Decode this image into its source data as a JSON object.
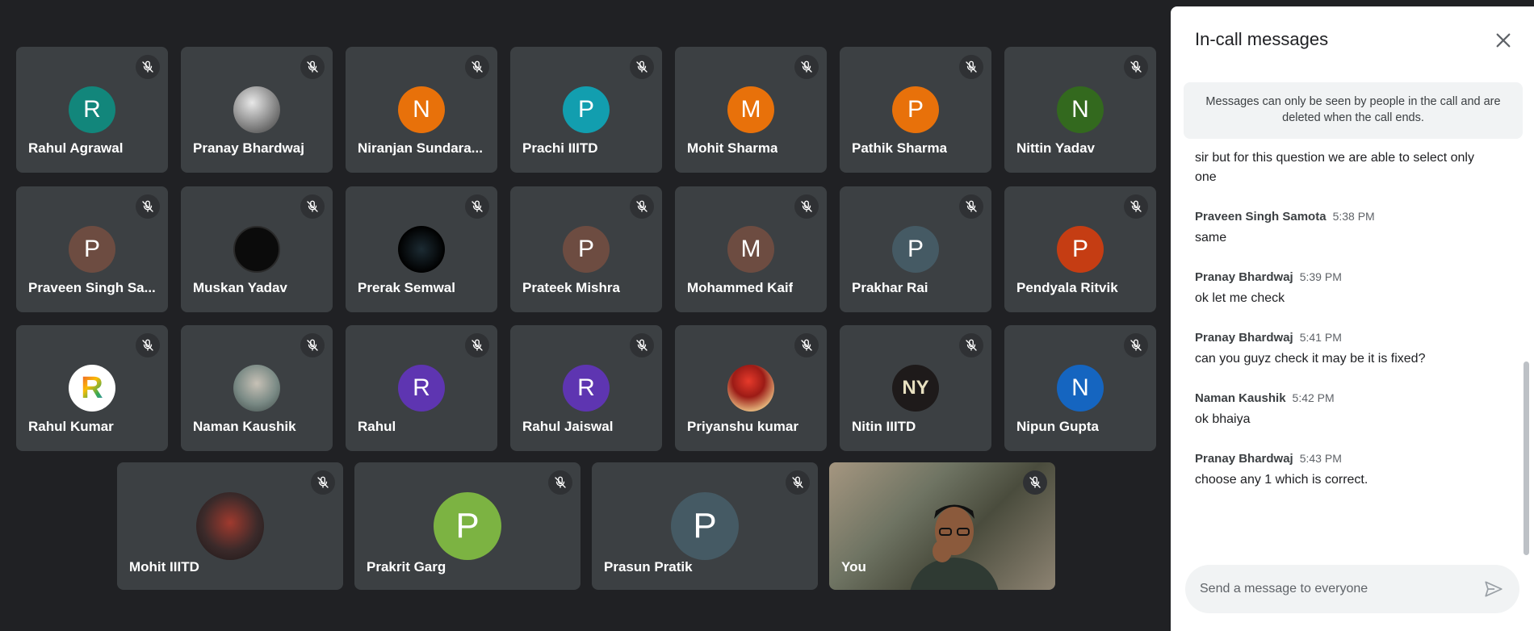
{
  "participants_row1": [
    {
      "name": "Rahul Agrawal",
      "initial": "R",
      "color": "#12867b"
    },
    {
      "name": "Pranay Bhardwaj",
      "initial": "",
      "photo": "photo-plain"
    },
    {
      "name": "Niranjan Sundara...",
      "initial": "N",
      "color": "#e8710a"
    },
    {
      "name": "Prachi IIITD",
      "initial": "P",
      "color": "#129eaf"
    },
    {
      "name": "Mohit Sharma",
      "initial": "M",
      "color": "#e8710a"
    },
    {
      "name": "Pathik Sharma",
      "initial": "P",
      "color": "#e8710a"
    },
    {
      "name": "Nittin Yadav",
      "initial": "N",
      "color": "#33691e"
    }
  ],
  "participants_row2": [
    {
      "name": "Praveen Singh Sa...",
      "initial": "P",
      "color": "#6d4c41"
    },
    {
      "name": "Muskan Yadav",
      "initial": "",
      "photo": "photo-black"
    },
    {
      "name": "Prerak Semwal",
      "initial": "",
      "photo": "photo-dark"
    },
    {
      "name": "Prateek Mishra",
      "initial": "P",
      "color": "#6d4c41"
    },
    {
      "name": "Mohammed Kaif",
      "initial": "M",
      "color": "#6d4c41"
    },
    {
      "name": "Prakhar Rai",
      "initial": "P",
      "color": "#455a64"
    },
    {
      "name": "Pendyala Ritvik",
      "initial": "P",
      "color": "#c53d13"
    }
  ],
  "participants_row3": [
    {
      "name": "Rahul Kumar",
      "initial": "R",
      "color": "#ffffff",
      "logo": true
    },
    {
      "name": "Naman Kaushik",
      "initial": "",
      "photo": "photo-man"
    },
    {
      "name": "Rahul",
      "initial": "R",
      "color": "#5e35b1"
    },
    {
      "name": "Rahul Jaiswal",
      "initial": "R",
      "color": "#5e35b1"
    },
    {
      "name": "Priyanshu kumar",
      "initial": "",
      "photo": "photo-red"
    },
    {
      "name": "Nitin IIITD",
      "initial": "NY",
      "color": "#1e1a1a"
    },
    {
      "name": "Nipun Gupta",
      "initial": "N",
      "color": "#1565c0"
    }
  ],
  "participants_row4": [
    {
      "name": "Mohit IIITD",
      "initial": "",
      "photo": "photo-art"
    },
    {
      "name": "Prakrit Garg",
      "initial": "P",
      "color": "#7cb342"
    },
    {
      "name": "Prasun Pratik",
      "initial": "P",
      "color": "#455a64"
    },
    {
      "name": "You",
      "self": true
    }
  ],
  "panel": {
    "title": "In-call messages",
    "notice": "Messages can only be seen by people in the call and are deleted when the call ends.",
    "compose_placeholder": "Send a message to everyone"
  },
  "messages": [
    {
      "sender": "",
      "time": "",
      "text": "sir but for this question we are able to select only one"
    },
    {
      "sender": "Praveen Singh Samota",
      "time": "5:38 PM",
      "text": "same"
    },
    {
      "sender": "Pranay Bhardwaj",
      "time": "5:39 PM",
      "text": "ok let me check"
    },
    {
      "sender": "Pranay Bhardwaj",
      "time": "5:41 PM",
      "text": "can you guyz check it may be it is fixed?"
    },
    {
      "sender": "Naman Kaushik",
      "time": "5:42 PM",
      "text": "ok bhaiya"
    },
    {
      "sender": "Pranay Bhardwaj",
      "time": "5:43 PM",
      "text": " choose any 1 which is correct."
    }
  ]
}
